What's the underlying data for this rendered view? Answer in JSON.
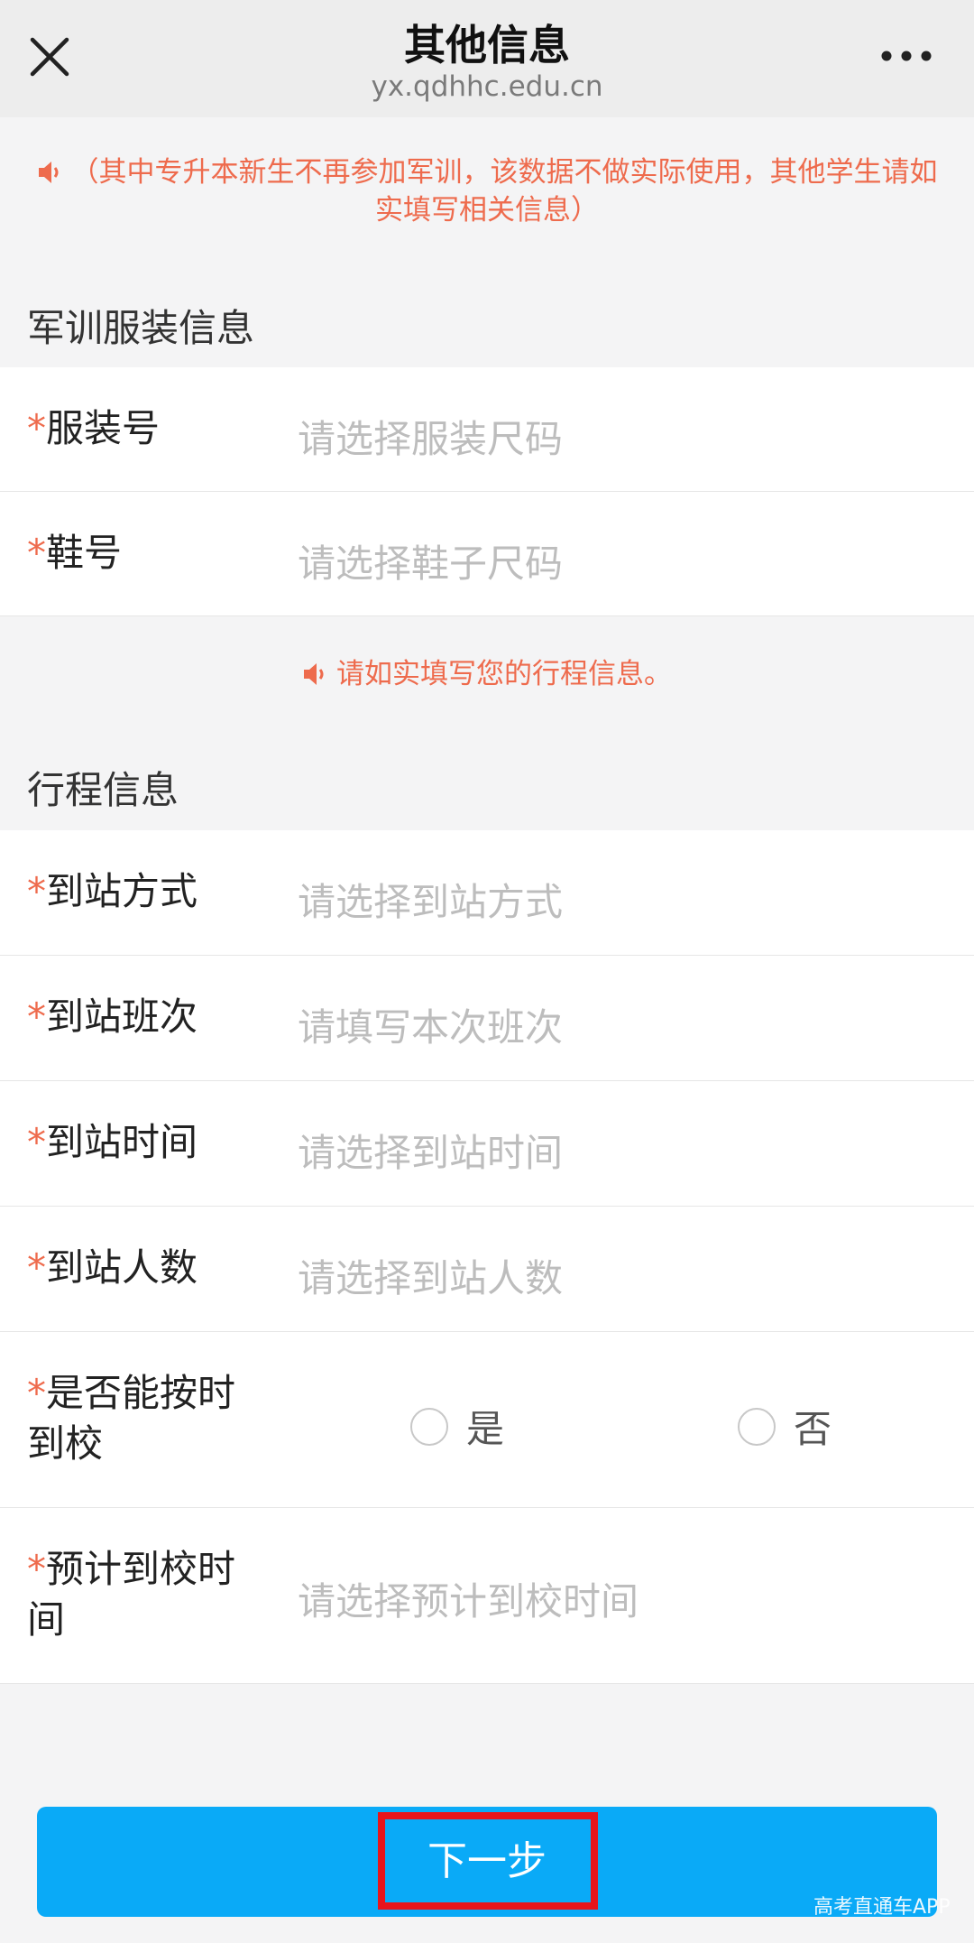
{
  "header": {
    "title": "其他信息",
    "url": "yx.qdhhc.edu.cn"
  },
  "notice_top": "（其中专升本新生不再参加军训，该数据不做实际使用，其他学生请如实填写相关信息）",
  "military": {
    "section_title": "军训服装信息",
    "fields": [
      {
        "star": "*",
        "label": "服装号",
        "placeholder": "请选择服装尺码"
      },
      {
        "star": "*",
        "label": "鞋号",
        "placeholder": "请选择鞋子尺码"
      }
    ]
  },
  "notice_mid": "请如实填写您的行程信息。",
  "travel": {
    "section_title": "行程信息",
    "fields": [
      {
        "star": "*",
        "label": "到站方式",
        "placeholder": "请选择到站方式"
      },
      {
        "star": "*",
        "label": "到站班次",
        "placeholder": "请填写本次班次"
      },
      {
        "star": "*",
        "label": "到站时间",
        "placeholder": "请选择到站时间"
      },
      {
        "star": "*",
        "label": "到站人数",
        "placeholder": "请选择到站人数"
      }
    ],
    "ontime": {
      "star": "*",
      "label": "是否能按时到校",
      "option_yes": "是",
      "option_no": "否"
    },
    "expected": {
      "star": "*",
      "label": "预计到校时间",
      "placeholder": "请选择预计到校时间"
    }
  },
  "next_button": "下一步",
  "watermark": "高考直通车APP",
  "colors": {
    "accent": "#0aaaf7",
    "required": "#ee6b4d",
    "highlight": "#e8141b"
  },
  "icons": [
    "close-icon",
    "more-icon",
    "speaker-icon"
  ]
}
